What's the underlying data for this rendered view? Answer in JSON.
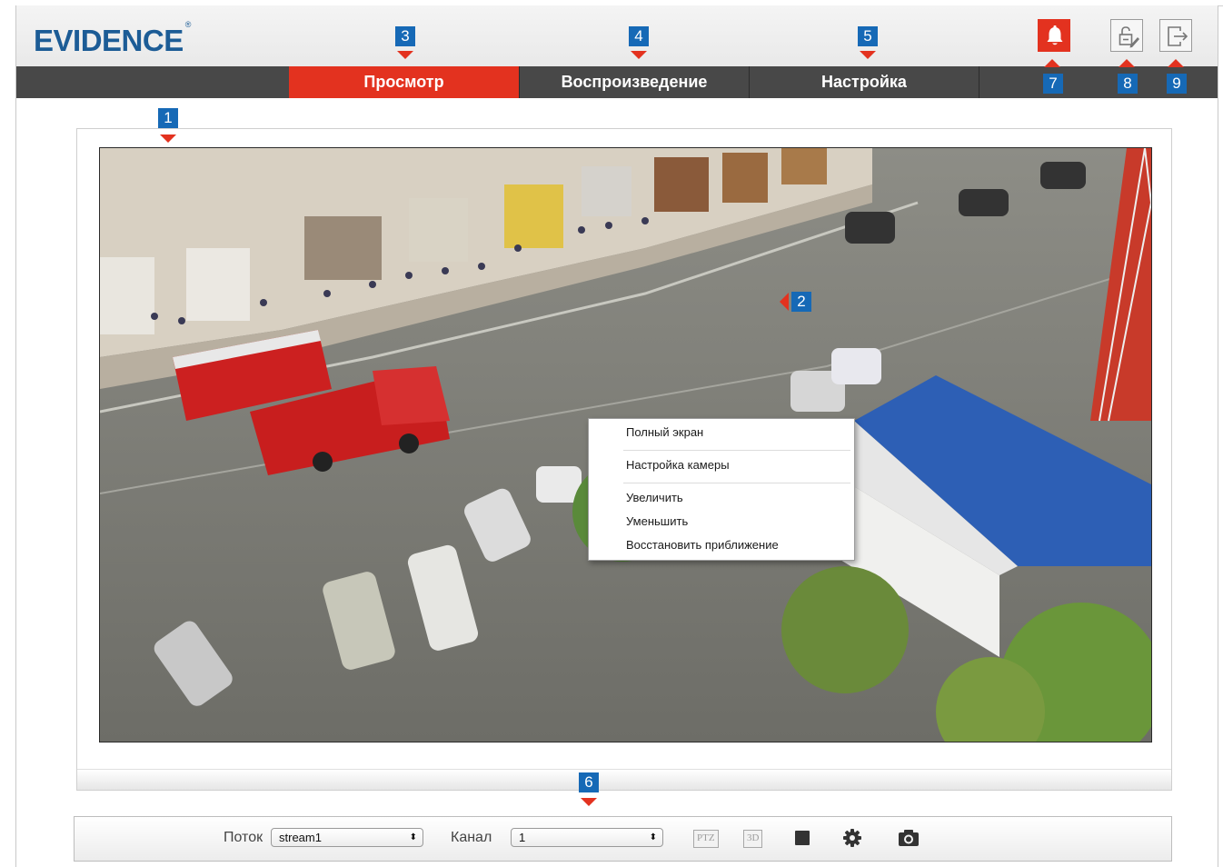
{
  "header": {
    "logo_text": "EVIDENCE",
    "logo_mark": "®",
    "icons": [
      "alarm-bell-icon",
      "edit-password-icon",
      "logout-icon"
    ]
  },
  "nav": {
    "tabs": [
      {
        "label": "Просмотр",
        "active": true
      },
      {
        "label": "Воспроизведение",
        "active": false
      },
      {
        "label": "Настройка",
        "active": false
      }
    ]
  },
  "context_menu": {
    "items": [
      "Полный экран",
      "Настройка камеры",
      "Увеличить",
      "Уменьшить",
      "Восстановить приближение"
    ]
  },
  "controls": {
    "stream_label": "Поток",
    "stream_value": "stream1",
    "channel_label": "Канал",
    "channel_value": "1",
    "ptz_label": "PTZ",
    "threed_label": "3D",
    "icons": [
      "stop-icon",
      "gear-icon",
      "camera-icon"
    ]
  },
  "markers": [
    "1",
    "2",
    "3",
    "4",
    "5",
    "6",
    "7",
    "8",
    "9"
  ],
  "colors": {
    "accent": "#e3321f",
    "nav_bg": "#484848",
    "marker_blue": "#1669b6",
    "logo_blue": "#1c5c96"
  }
}
